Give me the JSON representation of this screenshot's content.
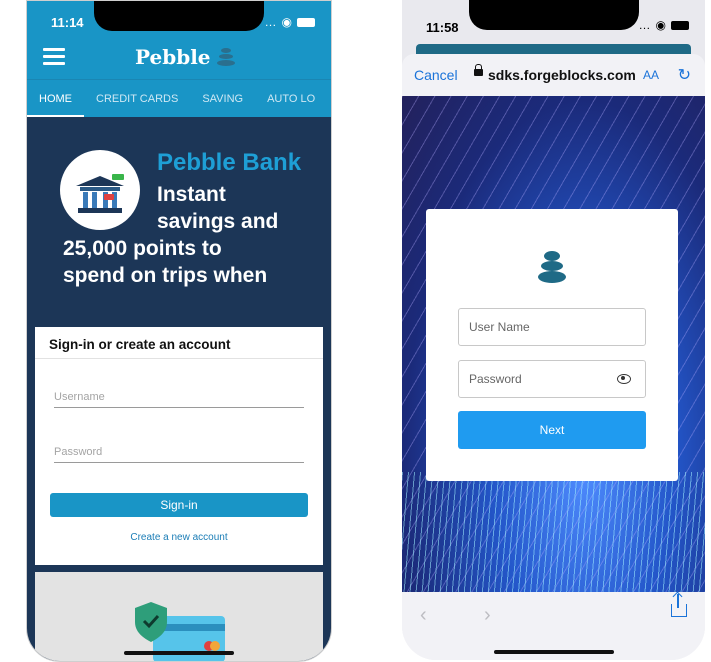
{
  "left": {
    "status": {
      "time": "11:14"
    },
    "brand": {
      "name": "Pebble"
    },
    "tabs": [
      "HOME",
      "CREDIT CARDS",
      "SAVING",
      "AUTO LO"
    ],
    "hero": {
      "title": "Pebble Bank",
      "lines": [
        "Instant",
        "savings and",
        "25,000 points to",
        "spend on trips when"
      ]
    },
    "signin": {
      "heading": "Sign-in or create an account",
      "username_placeholder": "Username",
      "password_placeholder": "Password",
      "button": "Sign-in",
      "create_link": "Create a new account"
    },
    "colors": {
      "brand_blue": "#1995c6",
      "hero_bg": "#1c3657",
      "hero_title": "#1e9fd6"
    }
  },
  "right": {
    "status": {
      "time": "11:58"
    },
    "browser": {
      "cancel": "Cancel",
      "url": "sdks.forgeblocks.com",
      "text_size": "AA"
    },
    "login": {
      "username_placeholder": "User Name",
      "password_placeholder": "Password",
      "button": "Next"
    },
    "colors": {
      "accent": "#1f9bf0",
      "logo": "#1f6a86",
      "link": "#1a73d9"
    }
  }
}
